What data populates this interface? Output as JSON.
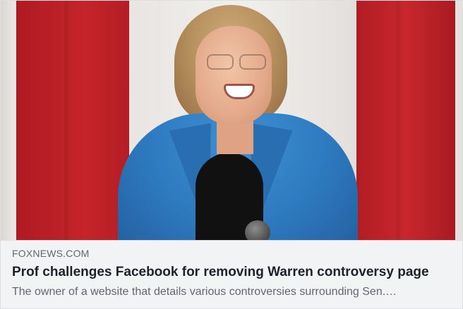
{
  "link_preview": {
    "domain": "FOXNEWS.COM",
    "title": "Prof challenges Facebook for removing Warren controversy page",
    "description": "The owner of a website that details various controversies surrounding Sen.…"
  },
  "colors": {
    "card_background": "#f2f3f5",
    "title_text": "#1d2129",
    "secondary_text": "#606770",
    "flag_red": "#c4242a",
    "jacket_blue": "#2f7bc1"
  }
}
